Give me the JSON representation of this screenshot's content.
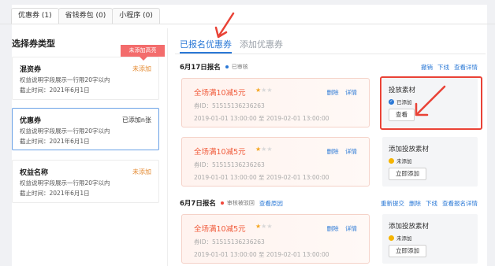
{
  "top_tabs": [
    {
      "label": "优惠券 (1)"
    },
    {
      "label": "省钱券包 (0)"
    },
    {
      "label": "小程序 (0)"
    }
  ],
  "left": {
    "title": "选择券类型",
    "tooltip": "未添加高亮",
    "cards": [
      {
        "name": "混资券",
        "status": "未添加",
        "desc": "权益说明字段展示一行限20字以内",
        "date": "截止时间：2021年6月1日"
      },
      {
        "name": "优惠券",
        "status": "已添加n张",
        "desc": "权益说明字段展示一行限20字以内",
        "date": "截止时间：2021年6月1日"
      },
      {
        "name": "权益名称",
        "status": "未添加",
        "desc": "权益说明字段展示一行限20字以内",
        "date": "截止时间：2021年6月1日"
      }
    ]
  },
  "right": {
    "tabs": [
      {
        "label": "已报名优惠券"
      },
      {
        "label": "添加优惠券"
      }
    ],
    "sections": [
      {
        "date": "6月17日报名",
        "status": "已审核",
        "status_color": "#2a78d6",
        "link": "",
        "actions": [
          "撤销",
          "下线",
          "查看详情"
        ]
      },
      {
        "date": "6月7日报名",
        "status": "审核被驳回",
        "status_color": "#f0483c",
        "link": "查看原因",
        "actions": [
          "重新提交",
          "删除",
          "下线",
          "查看报名详情"
        ]
      }
    ],
    "items": [
      {
        "title": "全场满10减5元",
        "rating": 1,
        "actions": [
          "删除",
          "详情"
        ],
        "id": "券ID：51515136236263",
        "time": "2019-01-01 13:00:00 至 2019-02-01 13:00:00",
        "material_title": "投放素材",
        "material_status": "已添加",
        "material_status_color": "#2a78d6",
        "material_button": "查看"
      },
      {
        "title": "全场满10减5元",
        "rating": 1,
        "actions": [
          "删除",
          "详情"
        ],
        "id": "券ID：51515136236263",
        "time": "2019-01-01 13:00:00 至 2019-02-01 13:00:00",
        "material_title": "添加投放素材",
        "material_status": "未添加",
        "material_status_color": "#f5b400",
        "material_button": "立即添加"
      },
      {
        "title": "全场满10减5元",
        "rating": 1,
        "actions": [
          "删除",
          "详情"
        ],
        "id": "券ID：51515136236263",
        "time": "2019-01-01 13:00:00 至 2019-02-01 13:00:00",
        "material_title": "添加投放素材",
        "material_status": "未添加",
        "material_status_color": "#f5b400",
        "material_button": "立即添加"
      }
    ]
  },
  "colors": {
    "accent": "#2a78d6",
    "danger": "#e94236",
    "warning": "#e48a31"
  }
}
